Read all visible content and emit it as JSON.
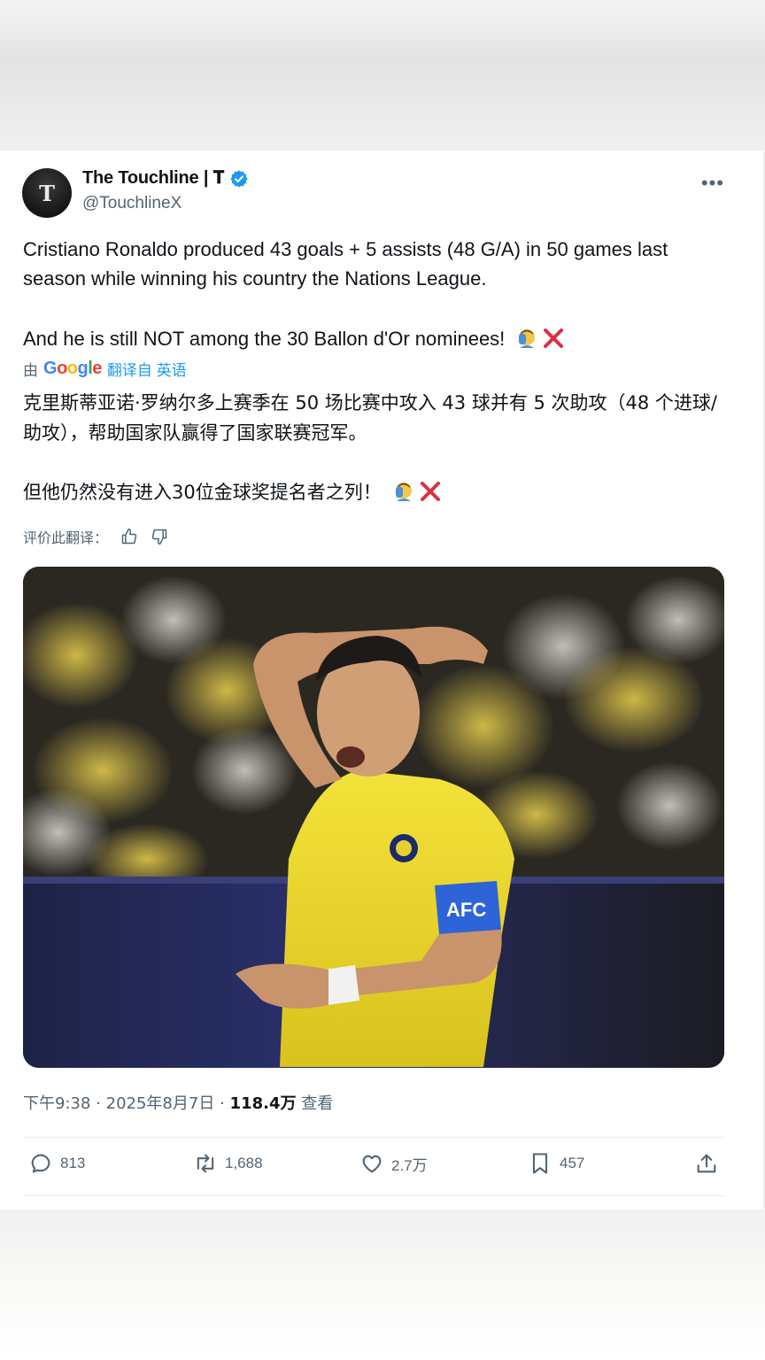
{
  "tweet": {
    "author": {
      "display_name": "The Touchline | 𝐓",
      "handle": "@TouchlineX",
      "avatar_letter": "T"
    },
    "text_en_1": "Cristiano Ronaldo produced 43 goals + 5 assists (48 G/A) in 50 games last season while winning his country the Nations League.",
    "text_en_2": "And he is still NOT among the 30 Ballon d'Or nominees!",
    "translate": {
      "by": "由",
      "google_letters": [
        "G",
        "o",
        "o",
        "g",
        "l",
        "e"
      ],
      "translated_from": "翻译自 英语"
    },
    "text_zh_1": "克里斯蒂亚诺·罗纳尔多上赛季在 50 场比赛中攻入 43 球并有 5 次助攻（48 个进球/助攻），帮助国家队赢得了国家联赛冠军。",
    "text_zh_2": "但他仍然没有进入30位金球奖提名者之列！",
    "rate_label": "评价此翻译：",
    "meta": {
      "time": "下午9:38",
      "date": "2025年8月7日",
      "views": "118.4万",
      "views_label": "查看",
      "sep": "·"
    },
    "stats": {
      "replies": "813",
      "retweets": "1,688",
      "likes": "2.7万",
      "bookmarks": "457"
    }
  },
  "colors": {
    "primary_text": "#0f1419",
    "secondary_text": "#536471",
    "link": "#1d9bf0",
    "verified": "#1d9bf0"
  }
}
